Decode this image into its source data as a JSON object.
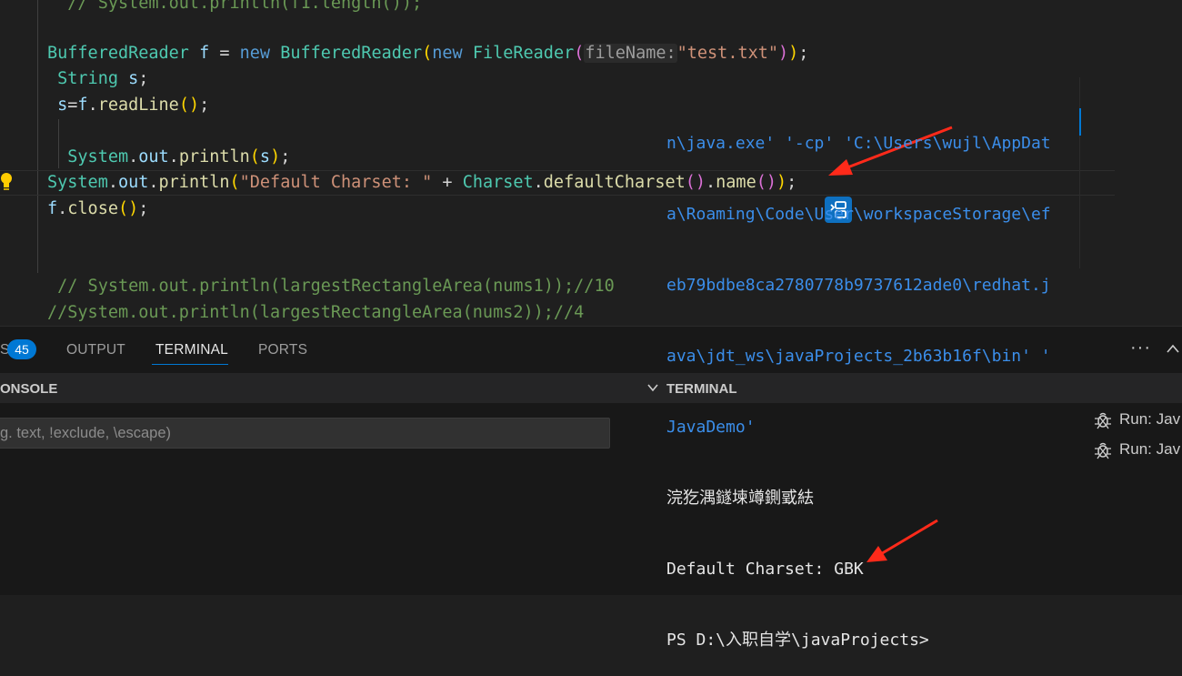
{
  "editor": {
    "lines": [
      [
        {
          "t": "  // System.out.println(f1.length());",
          "c": "cm"
        }
      ],
      [],
      [
        {
          "t": "BufferedReader",
          "c": "cl"
        },
        {
          "t": " ",
          "c": "pn"
        },
        {
          "t": "f",
          "c": "vr"
        },
        {
          "t": " = ",
          "c": "pn"
        },
        {
          "t": "new",
          "c": "kw"
        },
        {
          "t": " ",
          "c": "pn"
        },
        {
          "t": "BufferedReader",
          "c": "cl"
        },
        {
          "t": "(",
          "c": "p1"
        },
        {
          "t": "new",
          "c": "kw"
        },
        {
          "t": " ",
          "c": "pn"
        },
        {
          "t": "FileReader",
          "c": "cl"
        },
        {
          "t": "(",
          "c": "p2"
        },
        {
          "t": "fileName:",
          "c": "hint"
        },
        {
          "t": "\"test.txt\"",
          "c": "st"
        },
        {
          "t": ")",
          "c": "p2"
        },
        {
          "t": ")",
          "c": "p1"
        },
        {
          "t": ";",
          "c": "pn"
        }
      ],
      [
        {
          "t": " ",
          "c": "pn"
        },
        {
          "t": "String",
          "c": "cl"
        },
        {
          "t": " ",
          "c": "pn"
        },
        {
          "t": "s",
          "c": "vr"
        },
        {
          "t": ";",
          "c": "pn"
        }
      ],
      [
        {
          "t": " ",
          "c": "pn"
        },
        {
          "t": "s",
          "c": "vr"
        },
        {
          "t": "=",
          "c": "pn"
        },
        {
          "t": "f",
          "c": "vr"
        },
        {
          "t": ".",
          "c": "pn"
        },
        {
          "t": "readLine",
          "c": "fn"
        },
        {
          "t": "()",
          "c": "p1"
        },
        {
          "t": ";",
          "c": "pn"
        }
      ],
      [],
      [
        {
          "t": "  ",
          "c": "pn"
        },
        {
          "t": "System",
          "c": "cl"
        },
        {
          "t": ".",
          "c": "pn"
        },
        {
          "t": "out",
          "c": "vr"
        },
        {
          "t": ".",
          "c": "pn"
        },
        {
          "t": "println",
          "c": "fn"
        },
        {
          "t": "(",
          "c": "p1"
        },
        {
          "t": "s",
          "c": "vr"
        },
        {
          "t": ")",
          "c": "p1"
        },
        {
          "t": ";",
          "c": "pn"
        }
      ],
      [
        {
          "t": "System",
          "c": "cl"
        },
        {
          "t": ".",
          "c": "pn"
        },
        {
          "t": "out",
          "c": "vr"
        },
        {
          "t": ".",
          "c": "pn"
        },
        {
          "t": "println",
          "c": "fn"
        },
        {
          "t": "(",
          "c": "p1"
        },
        {
          "t": "\"Default Charset: \"",
          "c": "st"
        },
        {
          "t": " + ",
          "c": "pn"
        },
        {
          "t": "Charset",
          "c": "cl"
        },
        {
          "t": ".",
          "c": "pn"
        },
        {
          "t": "defaultCharset",
          "c": "fn"
        },
        {
          "t": "()",
          "c": "p2"
        },
        {
          "t": ".",
          "c": "pn"
        },
        {
          "t": "name",
          "c": "fn"
        },
        {
          "t": "()",
          "c": "p2"
        },
        {
          "t": ")",
          "c": "p1"
        },
        {
          "t": ";",
          "c": "pn"
        }
      ],
      [
        {
          "t": "f",
          "c": "vr"
        },
        {
          "t": ".",
          "c": "pn"
        },
        {
          "t": "close",
          "c": "fn"
        },
        {
          "t": "()",
          "c": "p1"
        },
        {
          "t": ";",
          "c": "pn"
        }
      ],
      [],
      [],
      [
        {
          "t": " // System.out.println(largestRectangleArea(nums1));//10",
          "c": "cm"
        }
      ],
      [
        {
          "t": "//System.out.println(largestRectangleArea(nums2));//4",
          "c": "cm"
        }
      ]
    ]
  },
  "panel": {
    "tabs": {
      "problems_partial": "S",
      "problems_count": "45",
      "output": "OUTPUT",
      "terminal": "TERMINAL",
      "ports": "PORTS"
    },
    "debug_console": {
      "title": "ONSOLE",
      "filter_placeholder": "g. text, !exclude, \\escape)"
    },
    "terminal": {
      "title": "TERMINAL",
      "lines": [
        {
          "text": "n\\java.exe' '-cp' 'C:\\Users\\wujl\\AppDat",
          "style": "blue"
        },
        {
          "text": "a\\Roaming\\Code\\User\\workspaceStorage\\ef",
          "style": "blue"
        },
        {
          "text": "eb79bdbe8ca2780778b9737612ade0\\redhat.j",
          "style": "blue"
        },
        {
          "text": "ava\\jdt_ws\\javaProjects_2b63b16f\\bin' '",
          "style": "blue"
        },
        {
          "text": "JavaDemo'",
          "style": "blue"
        },
        {
          "text": "浣犵湡鐩堜竴鍘戜紶",
          "style": "white"
        },
        {
          "text": "Default Charset: GBK",
          "style": "white"
        },
        {
          "text": "PS D:\\入职自学\\javaProjects>",
          "style": "white"
        }
      ],
      "instances": [
        {
          "label": "Run: Jav",
          "icon": "debug-bug-icon"
        },
        {
          "label": "Run: Jav",
          "icon": "debug-bug-icon"
        }
      ]
    }
  },
  "colors": {
    "accent": "#0078d4",
    "annotation_arrow": "#ff2a1a",
    "editor_bg": "#1f1f1f",
    "panel_bg": "#181818"
  }
}
